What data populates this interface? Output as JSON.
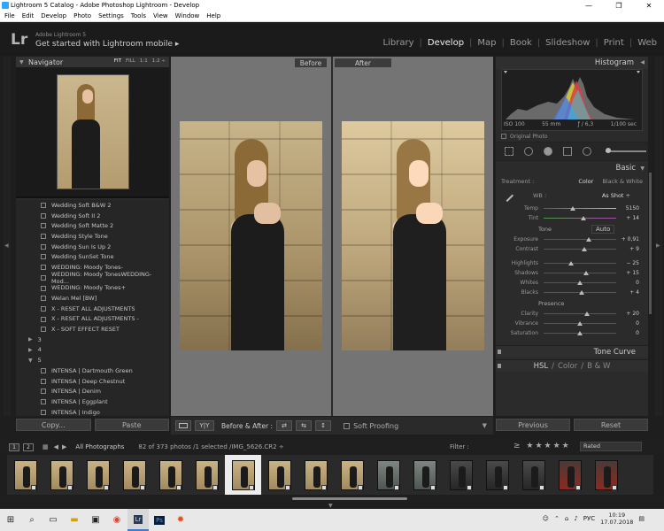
{
  "window": {
    "title": "Lightroom 5 Catalog - Adobe Photoshop Lightroom - Develop",
    "controls": [
      "—",
      "❐",
      "✕"
    ]
  },
  "menu": [
    "File",
    "Edit",
    "Develop",
    "Photo",
    "Settings",
    "Tools",
    "View",
    "Window",
    "Help"
  ],
  "identity": {
    "logo": "Lr",
    "product": "Adobe Lightroom 5",
    "mobile": "Get started with Lightroom mobile ▸"
  },
  "modules": [
    "Library",
    "Develop",
    "Map",
    "Book",
    "Slideshow",
    "Print",
    "Web"
  ],
  "active_module": "Develop",
  "navigator": {
    "title": "Navigator",
    "options": [
      "FIT",
      "FILL",
      "1:1",
      "1:2 ÷"
    ]
  },
  "presets": [
    {
      "type": "item",
      "label": "Wedding Soft B&W  2"
    },
    {
      "type": "item",
      "label": "Wedding Soft II 2"
    },
    {
      "type": "item",
      "label": "Wedding Soft Matte 2"
    },
    {
      "type": "item",
      "label": "Wedding Style Tone"
    },
    {
      "type": "item",
      "label": "Wedding Sun Is Up 2"
    },
    {
      "type": "item",
      "label": "Wedding SunSet Tone"
    },
    {
      "type": "item",
      "label": "WEDDING: Moody Tones-"
    },
    {
      "type": "item",
      "label": "WEDDING: Moody TonesWEDDING- Mod..."
    },
    {
      "type": "item",
      "label": "WEDDING: Moody Tones+"
    },
    {
      "type": "item",
      "label": "Welan Mel [BW]"
    },
    {
      "type": "item",
      "label": "X - RESET ALL ADJUSTMENTS"
    },
    {
      "type": "item",
      "label": "X - RESET ALL ADJUSTMENTS -"
    },
    {
      "type": "item",
      "label": "X - SOFT EFFECT RESET"
    },
    {
      "type": "folder",
      "label": "3",
      "arrow": "▶"
    },
    {
      "type": "folder",
      "label": "4",
      "arrow": "▶"
    },
    {
      "type": "folder",
      "label": "5",
      "arrow": "▼"
    },
    {
      "type": "item",
      "label": "INTENSA | Dartmouth Green"
    },
    {
      "type": "item",
      "label": "INTENSA | Deep Chestnut"
    },
    {
      "type": "item",
      "label": "INTENSA | Denim"
    },
    {
      "type": "item",
      "label": "INTENSA | Eggplant"
    },
    {
      "type": "item",
      "label": "INTENSA | Indigo"
    }
  ],
  "left_buttons": {
    "copy": "Copy...",
    "paste": "Paste"
  },
  "compare": {
    "before": "Before",
    "after": "After"
  },
  "toolbar": {
    "yy": "Y|Y",
    "before_after": "Before & After :",
    "soft_proofing": "Soft Proofing"
  },
  "histogram": {
    "title": "Histogram",
    "iso": "ISO 100",
    "focal": "55 mm",
    "aperture": "ƒ / 6,3",
    "shutter": "1/100 sec",
    "original_photo": "Original Photo"
  },
  "basic": {
    "title": "Basic",
    "treatment_label": "Treatment :",
    "color": "Color",
    "bw": "Black & White",
    "wb_label": "WB :",
    "wb_value": "As Shot ÷",
    "tone_label": "Tone",
    "auto": "Auto",
    "presence_label": "Presence",
    "wb_sliders": [
      {
        "label": "Temp",
        "value": "5150",
        "pos": 0.4
      },
      {
        "label": "Tint",
        "value": "+ 14",
        "pos": 0.55
      }
    ],
    "tone_sliders": [
      {
        "label": "Exposure",
        "value": "+ 0,91",
        "pos": 0.62
      },
      {
        "label": "Contrast",
        "value": "+ 9",
        "pos": 0.56
      }
    ],
    "tone_sliders2": [
      {
        "label": "Highlights",
        "value": "− 25",
        "pos": 0.38
      },
      {
        "label": "Shadows",
        "value": "+ 15",
        "pos": 0.58
      },
      {
        "label": "Whites",
        "value": "0",
        "pos": 0.5
      },
      {
        "label": "Blacks",
        "value": "+ 4",
        "pos": 0.52
      }
    ],
    "presence_sliders": [
      {
        "label": "Clarity",
        "value": "+ 20",
        "pos": 0.6
      },
      {
        "label": "Vibrance",
        "value": "0",
        "pos": 0.5
      },
      {
        "label": "Saturation",
        "value": "0",
        "pos": 0.5
      }
    ]
  },
  "sections": {
    "tone_curve": "Tone Curve",
    "hsl": "HSL",
    "color": "Color",
    "bw": "B & W"
  },
  "right_buttons": {
    "previous": "Previous",
    "reset": "Reset"
  },
  "filmstrip_bar": {
    "page1": "1",
    "page2": "2",
    "source": "All Photographs",
    "count": "82 of 373 photos /1 selected /IMG_5626.CR2 ÷",
    "filter": "Filter :",
    "stars": "≥ ★★★★★",
    "rated": "Rated"
  },
  "filmstrip": [
    {
      "tone": "warm"
    },
    {
      "tone": "warm"
    },
    {
      "tone": "warm"
    },
    {
      "tone": "warm"
    },
    {
      "tone": "warm"
    },
    {
      "tone": "warm"
    },
    {
      "tone": "warm",
      "selected": true
    },
    {
      "tone": "warm"
    },
    {
      "tone": "warm"
    },
    {
      "tone": "warm"
    },
    {
      "tone": "teal"
    },
    {
      "tone": "teal"
    },
    {
      "tone": "dark"
    },
    {
      "tone": "dark"
    },
    {
      "tone": "dark"
    },
    {
      "tone": "red"
    },
    {
      "tone": "red"
    }
  ],
  "taskbar": {
    "time": "10:19",
    "date": "17.07.2018",
    "lang": "РУС",
    "ps": "Ps",
    "lr": "Lr"
  }
}
